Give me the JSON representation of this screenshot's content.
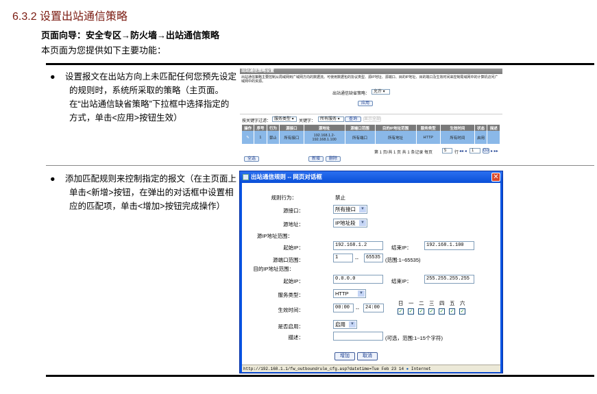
{
  "section_title": "6.3.2  设置出站通信策略",
  "page_nav": "页面向导：安全专区→防火墙→出站通信策略",
  "intro": "本页面为您提供如下主要功能：",
  "features": [
    {
      "lines": [
        "设置报文在出站方向上未匹配任何您预先设定",
        "的规则时，系统所采取的策略（主页面。",
        "在“出站通信缺省策略”下拉框中选择指定的",
        "方式，单击<应用>按钮生效）"
      ]
    },
    {
      "lines": [
        "添加匹配规则来控制指定的报文（在主页面上",
        "单击<新增>按钮，在弹出的对话框中设置相",
        "应的匹配项，单击<增加>按钮完成操作）"
      ]
    }
  ],
  "main_screen": {
    "title": "出站通信策略设置",
    "description": "出站通信策略主要控制从局域网到广域网方向的数据流。可使用数据包的协议类型、源IP地址、源端口、目的IP地址、目的端口及生效时间来控制局域网中的计算机访问广域网中的资源。",
    "default_policy_label": "出站通信缺省策略：",
    "default_policy_value": "允许",
    "apply_button": "应用",
    "filter_label": "按关键字过滤：",
    "filter_field": "服务类型",
    "keyword_label": "关键字：",
    "keyword_value": "所有服务",
    "search_button": "查询",
    "show_all_button": "显示全部",
    "columns": [
      "操作",
      "序号",
      "行为",
      "源接口",
      "源地址",
      "源端口范围",
      "目的IP地址范围",
      "服务类型",
      "生效时间",
      "状态",
      "描述"
    ],
    "rows": [
      {
        "index": "1",
        "action": "禁止",
        "src_if": "所有接口",
        "src_addr": "192.168.1.2-192.168.1.100",
        "src_port": "所有端口",
        "dst_ip": "所有地址",
        "service": "HTTP",
        "time": "所有时间",
        "status": "启用",
        "desc": ""
      }
    ],
    "pagination": "第 1 页/共 1 页 共 1 条记录 每页",
    "per_page": "5",
    "rows_label": "行",
    "page_input": "1",
    "go_button": "Go",
    "select_all_button": "全选",
    "new_button": "新增",
    "delete_button": "删除"
  },
  "dialog": {
    "title": "出站通信规则 -- 网页对话框",
    "rule_action_label": "规则行为：",
    "rule_action_value": "禁止",
    "src_if_label": "源接口：",
    "src_if_value": "所有接口",
    "src_addr_label": "源地址：",
    "src_addr_value": "IP地址段",
    "src_range_label": "源IP地址范围：",
    "start_ip_label": "起始IP：",
    "end_ip_label": "结束IP：",
    "src_start_ip": "192.168.1.2",
    "src_end_ip": "192.168.1.100",
    "src_port_label": "源端口范围：",
    "src_port_start": "1",
    "src_port_end": "65535",
    "range_sep": "--",
    "src_port_hint": "(范围:1~65535)",
    "dst_range_label": "目的IP地址范围：",
    "dst_start_ip": "0.0.0.0",
    "dst_end_ip": "255.255.255.255",
    "service_label": "服务类型：",
    "service_value": "HTTP",
    "time_label": "生效时间：",
    "time_start": "00:00",
    "time_end": "24:00",
    "weekdays": [
      "日",
      "一",
      "二",
      "三",
      "四",
      "五",
      "六"
    ],
    "weekday_checked": [
      true,
      true,
      true,
      true,
      true,
      true,
      true
    ],
    "enable_label": "是否启用：",
    "enable_value": "启用",
    "desc_label": "描述：",
    "desc_value": "",
    "desc_hint": "(可选，范围:1~15个字符)",
    "add_button": "增加",
    "cancel_button": "取消",
    "status_url": "http://192.168.1.1/fw_outboundrule_cfg.asp?datetime=Tue Feb 23 14",
    "status_zone": "Internet"
  },
  "colors": {
    "heading": "#7a1a10",
    "dialog_title": "#0a54e3",
    "table_row": "#8ab8e8"
  }
}
